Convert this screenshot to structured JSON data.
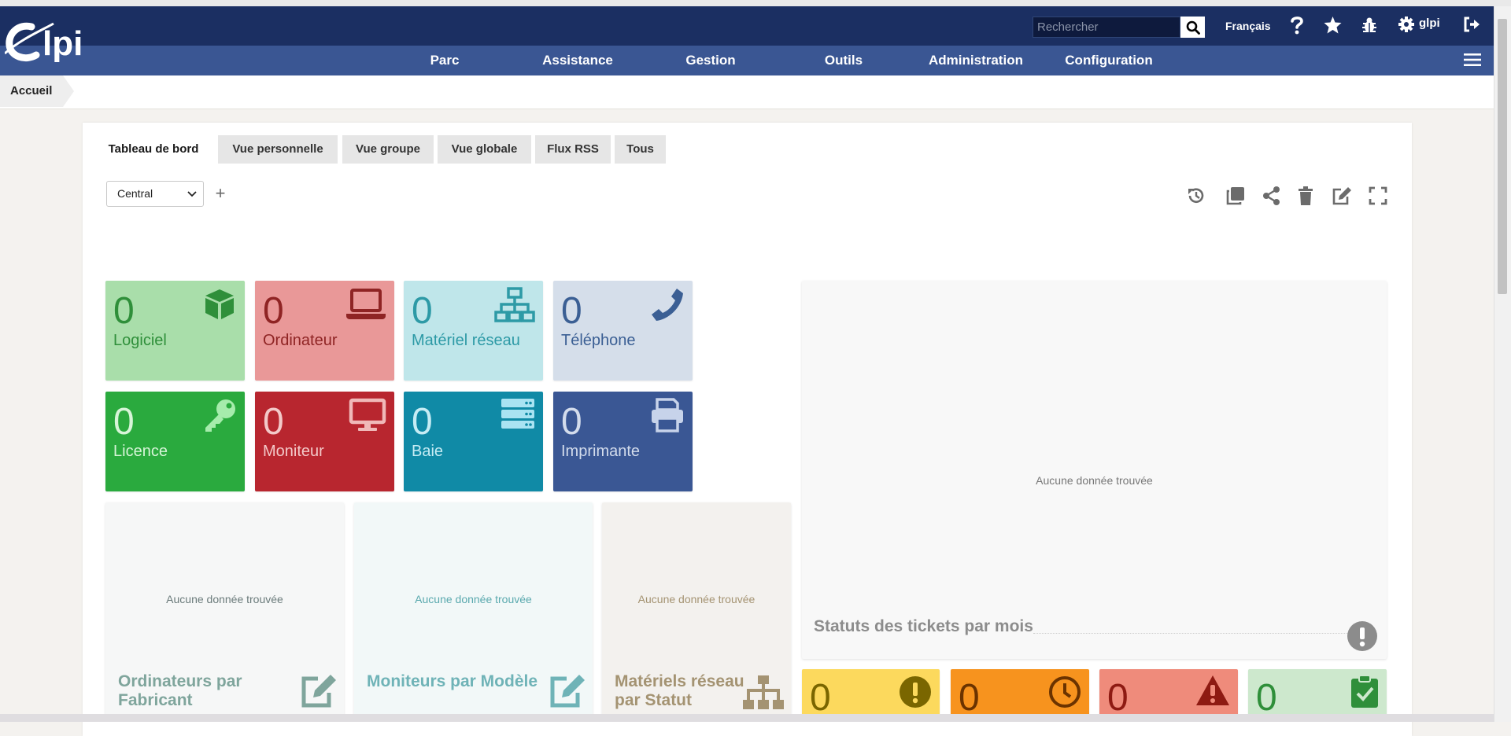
{
  "header": {
    "logo_text": "Glpi",
    "search_placeholder": "Rechercher",
    "language": "Français",
    "username": "glpi"
  },
  "nav": {
    "items": [
      {
        "label": "Parc"
      },
      {
        "label": "Assistance"
      },
      {
        "label": "Gestion"
      },
      {
        "label": "Outils"
      },
      {
        "label": "Administration"
      },
      {
        "label": "Configuration"
      }
    ]
  },
  "breadcrumb": {
    "home": "Accueil"
  },
  "tabs": [
    {
      "label": "Tableau de bord",
      "active": true
    },
    {
      "label": "Vue personnelle"
    },
    {
      "label": "Vue groupe"
    },
    {
      "label": "Vue globale"
    },
    {
      "label": "Flux RSS"
    },
    {
      "label": "Tous"
    }
  ],
  "dashboard_select": {
    "value": "Central",
    "add_label": "+"
  },
  "toolbar_icons": [
    "history-icon",
    "clone-icon",
    "share-icon",
    "delete-icon",
    "edit-icon",
    "fullscreen-icon"
  ],
  "cards": [
    {
      "value": "0",
      "label": "Logiciel",
      "icon": "box-icon",
      "bg": "#a9deaa",
      "fg": "#2f8f3a",
      "icon_color": "#2f8f3a"
    },
    {
      "value": "0",
      "label": "Ordinateur",
      "icon": "laptop-icon",
      "bg": "#e99898",
      "fg": "#8f2424",
      "icon_color": "#8f2424"
    },
    {
      "value": "0",
      "label": "Matériel réseau",
      "icon": "network-icon",
      "bg": "#bfe6ea",
      "fg": "#2d9aa6",
      "icon_color": "#2d9aa6"
    },
    {
      "value": "0",
      "label": "Téléphone",
      "icon": "phone-icon",
      "bg": "#d5deea",
      "fg": "#3b5f94",
      "icon_color": "#3b5f94"
    },
    {
      "value": "0",
      "label": "Licence",
      "icon": "key-icon",
      "bg": "#2aaa3e",
      "fg": "#d7f5d8",
      "icon_color": "#a6ecac"
    },
    {
      "value": "0",
      "label": "Moniteur",
      "icon": "monitor-icon",
      "bg": "#b8262f",
      "fg": "#f3c9c9",
      "icon_color": "#f0b8b8"
    },
    {
      "value": "0",
      "label": "Baie",
      "icon": "rack-icon",
      "bg": "#108aa6",
      "fg": "#c6ecf4",
      "icon_color": "#a9e3f2"
    },
    {
      "value": "0",
      "label": "Imprimante",
      "icon": "printer-icon",
      "bg": "#3a5794",
      "fg": "#d3dcec",
      "icon_color": "#c7d3ea"
    }
  ],
  "widgets": {
    "no_data": "Aucune donnée trouvée",
    "ordinateurs": {
      "title": "Ordinateurs par Fabricant",
      "icon": "edit-icon"
    },
    "moniteurs": {
      "title": "Moniteurs par Modèle",
      "icon": "edit-icon"
    },
    "reseau": {
      "title": "Matériels réseau par Statut",
      "icon": "sitemap-icon"
    },
    "tickets": {
      "title": "Statuts des tickets par mois",
      "icon": "exclamation-icon"
    }
  },
  "ticket_cards": [
    {
      "value": "0",
      "icon": "exclamation-circle-icon",
      "bg": "#fcd95d",
      "fg": "#7a6600"
    },
    {
      "value": "0",
      "icon": "clock-icon",
      "bg": "#f7931e",
      "fg": "#6b3300"
    },
    {
      "value": "0",
      "icon": "warning-icon",
      "bg": "#ef8b7b",
      "fg": "#8e1a12"
    },
    {
      "value": "0",
      "icon": "clipboard-check-icon",
      "bg": "#cde8cd",
      "fg": "#2f8f3a"
    }
  ]
}
